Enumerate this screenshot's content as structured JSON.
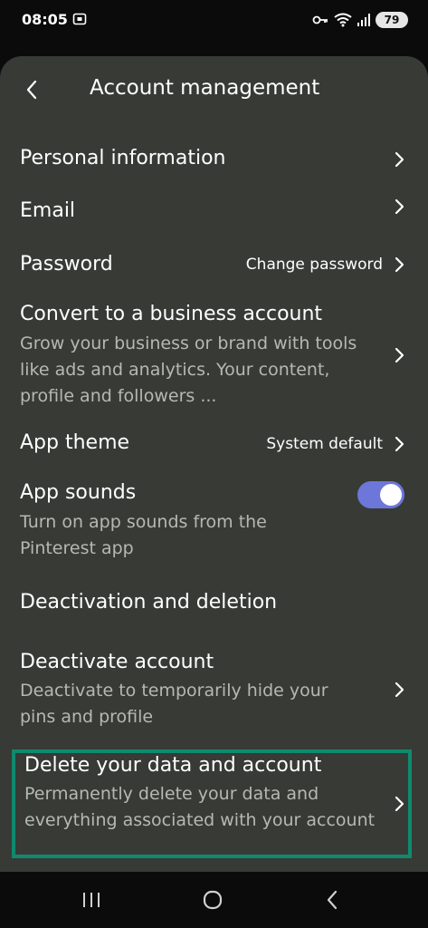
{
  "status_bar": {
    "time": "08:05",
    "battery": "79"
  },
  "header": {
    "title": "Account management"
  },
  "rows": {
    "personal_info": {
      "title": "Personal information"
    },
    "email": {
      "title": "Email"
    },
    "password": {
      "title": "Password",
      "value": "Change password"
    },
    "business": {
      "title": "Convert to a business account",
      "subtitle": "Grow your business or brand with tools like ads and analytics. Your content, profile and followers ..."
    },
    "theme": {
      "title": "App theme",
      "value": "System default"
    },
    "sounds": {
      "title": "App sounds",
      "subtitle": "Turn on app sounds from the Pinterest app",
      "enabled": true
    },
    "section_heading": "Deactivation and deletion",
    "deactivate": {
      "title": "Deactivate account",
      "subtitle": "Deactivate to temporarily hide your pins and profile"
    },
    "delete": {
      "title": "Delete your data and account",
      "subtitle": "Permanently delete your data and everything associated with your account"
    }
  },
  "colors": {
    "sheet_background": "#383a36",
    "toggle_on": "#6d76d9",
    "highlight_border": "#0f8a6e",
    "secondary_text": "#b7b8b3"
  }
}
